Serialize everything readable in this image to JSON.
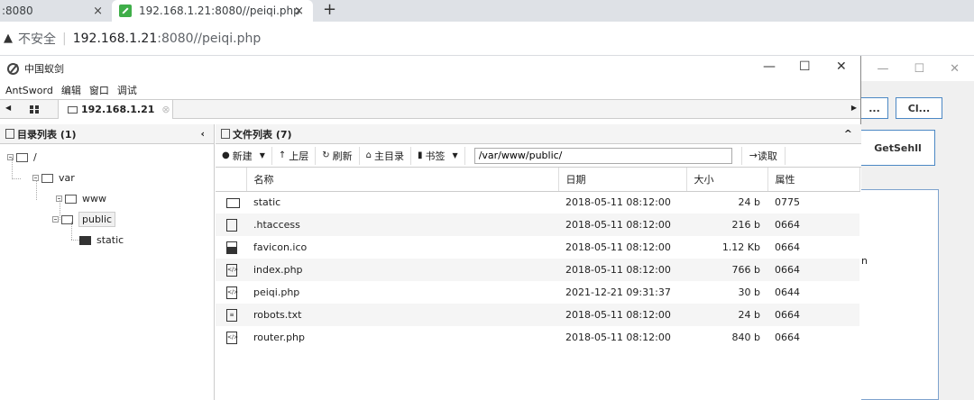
{
  "browser": {
    "inactive_tab": ":8080",
    "active_tab": "192.168.1.21:8080//peiqi.php",
    "tab_close": "×",
    "new_tab": "+",
    "insecure_label": "不安全",
    "url_host": "192.168.1.21",
    "url_rest": ":8080//peiqi.php"
  },
  "window": {
    "title": "中国蚁剑",
    "minimize": "—",
    "maximize": "☐",
    "close": "✕"
  },
  "menu": [
    "AntSword",
    "编辑",
    "窗口",
    "调试"
  ],
  "shell_tab": "192.168.1.21",
  "background_window": {
    "btn1": "...",
    "btn2": "Cl...",
    "btn3": "GetSehll",
    "partial_char": "n"
  },
  "dir_panel": {
    "title": "目录列表 (1)",
    "tree": [
      {
        "label": "/"
      },
      {
        "label": "var"
      },
      {
        "label": "www"
      },
      {
        "label": "public"
      },
      {
        "label": "static"
      }
    ]
  },
  "file_panel": {
    "title": "文件列表 (7)",
    "toolbar": {
      "new": "新建",
      "up": "上层",
      "refresh": "刷新",
      "home": "主目录",
      "bookmark": "书签",
      "path": "/var/www/public/",
      "read": "读取"
    },
    "columns": [
      "名称",
      "日期",
      "大小",
      "属性"
    ],
    "rows": [
      {
        "name": "static",
        "date": "2018-05-11 08:12:00",
        "size": "24 b",
        "attr": "0775",
        "icon": "folder-icon"
      },
      {
        "name": ".htaccess",
        "date": "2018-05-11 08:12:00",
        "size": "216 b",
        "attr": "0664",
        "icon": "file-icon"
      },
      {
        "name": "favicon.ico",
        "date": "2018-05-11 08:12:00",
        "size": "1.12 Kb",
        "attr": "0664",
        "icon": "image-file-icon"
      },
      {
        "name": "index.php",
        "date": "2018-05-11 08:12:00",
        "size": "766 b",
        "attr": "0664",
        "icon": "code-file-icon"
      },
      {
        "name": "peiqi.php",
        "date": "2021-12-21 09:31:37",
        "size": "30 b",
        "attr": "0644",
        "icon": "code-file-icon"
      },
      {
        "name": "robots.txt",
        "date": "2018-05-11 08:12:00",
        "size": "24 b",
        "attr": "0664",
        "icon": "text-file-icon"
      },
      {
        "name": "router.php",
        "date": "2018-05-11 08:12:00",
        "size": "840 b",
        "attr": "0664",
        "icon": "code-file-icon"
      }
    ]
  }
}
